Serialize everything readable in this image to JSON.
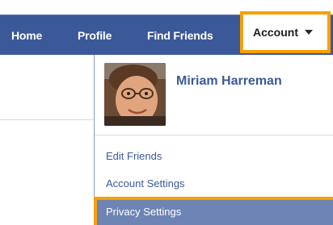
{
  "nav": {
    "home": "Home",
    "profile": "Profile",
    "find_friends": "Find Friends",
    "account": "Account"
  },
  "dropdown": {
    "user_name": "Miriam Harreman",
    "items": [
      {
        "label": "Edit Friends"
      },
      {
        "label": "Account Settings"
      },
      {
        "label": "Privacy Settings",
        "highlighted": true
      }
    ]
  },
  "colors": {
    "nav_bg": "#3b5998",
    "highlight": "#f7a000",
    "link": "#3b5998",
    "selected_bg": "#6d84b4"
  }
}
